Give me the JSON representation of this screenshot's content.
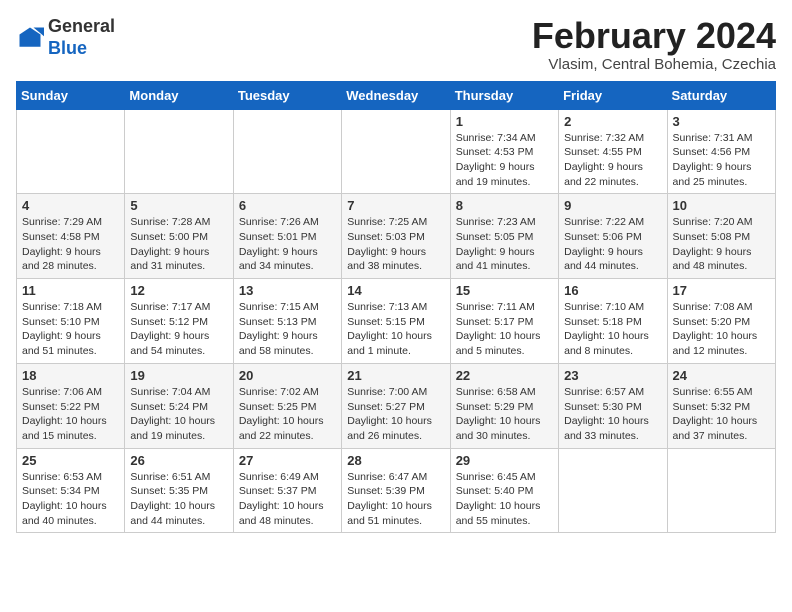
{
  "header": {
    "logo_line1": "General",
    "logo_line2": "Blue",
    "title": "February 2024",
    "subtitle": "Vlasim, Central Bohemia, Czechia"
  },
  "weekdays": [
    "Sunday",
    "Monday",
    "Tuesday",
    "Wednesday",
    "Thursday",
    "Friday",
    "Saturday"
  ],
  "weeks": [
    [
      {
        "day": "",
        "info": ""
      },
      {
        "day": "",
        "info": ""
      },
      {
        "day": "",
        "info": ""
      },
      {
        "day": "",
        "info": ""
      },
      {
        "day": "1",
        "info": "Sunrise: 7:34 AM\nSunset: 4:53 PM\nDaylight: 9 hours\nand 19 minutes."
      },
      {
        "day": "2",
        "info": "Sunrise: 7:32 AM\nSunset: 4:55 PM\nDaylight: 9 hours\nand 22 minutes."
      },
      {
        "day": "3",
        "info": "Sunrise: 7:31 AM\nSunset: 4:56 PM\nDaylight: 9 hours\nand 25 minutes."
      }
    ],
    [
      {
        "day": "4",
        "info": "Sunrise: 7:29 AM\nSunset: 4:58 PM\nDaylight: 9 hours\nand 28 minutes."
      },
      {
        "day": "5",
        "info": "Sunrise: 7:28 AM\nSunset: 5:00 PM\nDaylight: 9 hours\nand 31 minutes."
      },
      {
        "day": "6",
        "info": "Sunrise: 7:26 AM\nSunset: 5:01 PM\nDaylight: 9 hours\nand 34 minutes."
      },
      {
        "day": "7",
        "info": "Sunrise: 7:25 AM\nSunset: 5:03 PM\nDaylight: 9 hours\nand 38 minutes."
      },
      {
        "day": "8",
        "info": "Sunrise: 7:23 AM\nSunset: 5:05 PM\nDaylight: 9 hours\nand 41 minutes."
      },
      {
        "day": "9",
        "info": "Sunrise: 7:22 AM\nSunset: 5:06 PM\nDaylight: 9 hours\nand 44 minutes."
      },
      {
        "day": "10",
        "info": "Sunrise: 7:20 AM\nSunset: 5:08 PM\nDaylight: 9 hours\nand 48 minutes."
      }
    ],
    [
      {
        "day": "11",
        "info": "Sunrise: 7:18 AM\nSunset: 5:10 PM\nDaylight: 9 hours\nand 51 minutes."
      },
      {
        "day": "12",
        "info": "Sunrise: 7:17 AM\nSunset: 5:12 PM\nDaylight: 9 hours\nand 54 minutes."
      },
      {
        "day": "13",
        "info": "Sunrise: 7:15 AM\nSunset: 5:13 PM\nDaylight: 9 hours\nand 58 minutes."
      },
      {
        "day": "14",
        "info": "Sunrise: 7:13 AM\nSunset: 5:15 PM\nDaylight: 10 hours\nand 1 minute."
      },
      {
        "day": "15",
        "info": "Sunrise: 7:11 AM\nSunset: 5:17 PM\nDaylight: 10 hours\nand 5 minutes."
      },
      {
        "day": "16",
        "info": "Sunrise: 7:10 AM\nSunset: 5:18 PM\nDaylight: 10 hours\nand 8 minutes."
      },
      {
        "day": "17",
        "info": "Sunrise: 7:08 AM\nSunset: 5:20 PM\nDaylight: 10 hours\nand 12 minutes."
      }
    ],
    [
      {
        "day": "18",
        "info": "Sunrise: 7:06 AM\nSunset: 5:22 PM\nDaylight: 10 hours\nand 15 minutes."
      },
      {
        "day": "19",
        "info": "Sunrise: 7:04 AM\nSunset: 5:24 PM\nDaylight: 10 hours\nand 19 minutes."
      },
      {
        "day": "20",
        "info": "Sunrise: 7:02 AM\nSunset: 5:25 PM\nDaylight: 10 hours\nand 22 minutes."
      },
      {
        "day": "21",
        "info": "Sunrise: 7:00 AM\nSunset: 5:27 PM\nDaylight: 10 hours\nand 26 minutes."
      },
      {
        "day": "22",
        "info": "Sunrise: 6:58 AM\nSunset: 5:29 PM\nDaylight: 10 hours\nand 30 minutes."
      },
      {
        "day": "23",
        "info": "Sunrise: 6:57 AM\nSunset: 5:30 PM\nDaylight: 10 hours\nand 33 minutes."
      },
      {
        "day": "24",
        "info": "Sunrise: 6:55 AM\nSunset: 5:32 PM\nDaylight: 10 hours\nand 37 minutes."
      }
    ],
    [
      {
        "day": "25",
        "info": "Sunrise: 6:53 AM\nSunset: 5:34 PM\nDaylight: 10 hours\nand 40 minutes."
      },
      {
        "day": "26",
        "info": "Sunrise: 6:51 AM\nSunset: 5:35 PM\nDaylight: 10 hours\nand 44 minutes."
      },
      {
        "day": "27",
        "info": "Sunrise: 6:49 AM\nSunset: 5:37 PM\nDaylight: 10 hours\nand 48 minutes."
      },
      {
        "day": "28",
        "info": "Sunrise: 6:47 AM\nSunset: 5:39 PM\nDaylight: 10 hours\nand 51 minutes."
      },
      {
        "day": "29",
        "info": "Sunrise: 6:45 AM\nSunset: 5:40 PM\nDaylight: 10 hours\nand 55 minutes."
      },
      {
        "day": "",
        "info": ""
      },
      {
        "day": "",
        "info": ""
      }
    ]
  ]
}
